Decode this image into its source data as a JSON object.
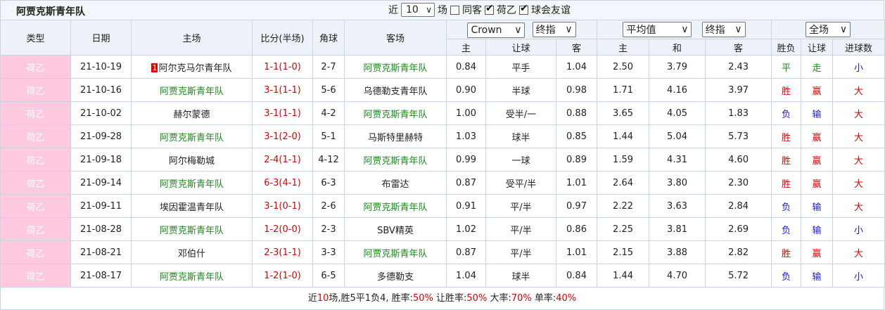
{
  "header": {
    "title": "阿贾克斯青年队",
    "filter_prefix": "近",
    "count_value": "10",
    "filter_suffix": "场",
    "opt_same_side": "同客",
    "opt_same_side_checked": false,
    "opt_league": "荷乙",
    "opt_league_checked": true,
    "opt_friendly": "球会友谊",
    "opt_friendly_checked": true
  },
  "columns": {
    "type": "类型",
    "date": "日期",
    "home": "主场",
    "score": "比分(半场)",
    "corners": "角球",
    "away": "客场",
    "company_select": "Crown",
    "odds_type_select": "终指",
    "avg_select": "平均值",
    "avg_type_select": "终指",
    "scope_select": "全场",
    "sub_home": "主",
    "sub_handicap": "让球",
    "sub_away": "客",
    "sub_home2": "主",
    "sub_draw": "和",
    "sub_away2": "客",
    "sub_result": "胜负",
    "sub_hcap_result": "让球",
    "sub_goals": "进球数"
  },
  "rows": [
    {
      "type": "荷乙",
      "date": "21-10-19",
      "home": "阿尔克马尔青年队",
      "home_rank": "1",
      "home_is_team": false,
      "score": "1-1",
      "half": "(1-0)",
      "corners": "2-7",
      "away": "阿贾克斯青年队",
      "away_is_team": true,
      "h": "0.84",
      "hcap": "平手",
      "a": "1.04",
      "avg_h": "2.50",
      "avg_d": "3.79",
      "avg_a": "2.43",
      "res": "平",
      "res_c": "draw",
      "hres": "走",
      "hres_c": "draw",
      "goals": "小",
      "goals_c": "lose"
    },
    {
      "type": "荷乙",
      "date": "21-10-16",
      "home": "阿贾克斯青年队",
      "home_rank": "",
      "home_is_team": true,
      "score": "3-1",
      "half": "(1-1)",
      "corners": "5-6",
      "away": "乌德勒支青年队",
      "away_is_team": false,
      "h": "0.90",
      "hcap": "半球",
      "a": "0.98",
      "avg_h": "1.71",
      "avg_d": "4.16",
      "avg_a": "3.97",
      "res": "胜",
      "res_c": "win",
      "hres": "赢",
      "hres_c": "win",
      "goals": "大",
      "goals_c": "win"
    },
    {
      "type": "荷乙",
      "date": "21-10-02",
      "home": "赫尔蒙德",
      "home_rank": "",
      "home_is_team": false,
      "score": "3-1",
      "half": "(1-1)",
      "corners": "4-2",
      "away": "阿贾克斯青年队",
      "away_is_team": true,
      "h": "1.00",
      "hcap": "受半/一",
      "a": "0.88",
      "avg_h": "3.65",
      "avg_d": "4.05",
      "avg_a": "1.83",
      "res": "负",
      "res_c": "lose",
      "hres": "输",
      "hres_c": "lose",
      "goals": "大",
      "goals_c": "win"
    },
    {
      "type": "荷乙",
      "date": "21-09-28",
      "home": "阿贾克斯青年队",
      "home_rank": "",
      "home_is_team": true,
      "score": "3-1",
      "half": "(2-0)",
      "corners": "5-1",
      "away": "马斯特里赫特",
      "away_is_team": false,
      "h": "1.03",
      "hcap": "球半",
      "a": "0.85",
      "avg_h": "1.44",
      "avg_d": "5.04",
      "avg_a": "5.73",
      "res": "胜",
      "res_c": "win",
      "hres": "赢",
      "hres_c": "win",
      "goals": "大",
      "goals_c": "win"
    },
    {
      "type": "荷乙",
      "date": "21-09-18",
      "home": "阿尔梅勒城",
      "home_rank": "",
      "home_is_team": false,
      "score": "2-4",
      "half": "(1-1)",
      "corners": "4-12",
      "away": "阿贾克斯青年队",
      "away_is_team": true,
      "h": "0.99",
      "hcap": "一球",
      "a": "0.89",
      "avg_h": "1.59",
      "avg_d": "4.31",
      "avg_a": "4.60",
      "res": "胜",
      "res_c": "win",
      "hres": "赢",
      "hres_c": "win",
      "goals": "大",
      "goals_c": "win"
    },
    {
      "type": "荷乙",
      "date": "21-09-14",
      "home": "阿贾克斯青年队",
      "home_rank": "",
      "home_is_team": true,
      "score": "6-3",
      "half": "(4-1)",
      "corners": "6-3",
      "away": "布雷达",
      "away_is_team": false,
      "h": "0.87",
      "hcap": "受平/半",
      "a": "1.01",
      "avg_h": "2.64",
      "avg_d": "3.80",
      "avg_a": "2.30",
      "res": "胜",
      "res_c": "win",
      "hres": "赢",
      "hres_c": "win",
      "goals": "大",
      "goals_c": "win"
    },
    {
      "type": "荷乙",
      "date": "21-09-11",
      "home": "埃因霍温青年队",
      "home_rank": "",
      "home_is_team": false,
      "score": "3-1",
      "half": "(0-1)",
      "corners": "2-6",
      "away": "阿贾克斯青年队",
      "away_is_team": true,
      "h": "0.91",
      "hcap": "平/半",
      "a": "0.97",
      "avg_h": "2.22",
      "avg_d": "3.63",
      "avg_a": "2.84",
      "res": "负",
      "res_c": "lose",
      "hres": "输",
      "hres_c": "lose",
      "goals": "大",
      "goals_c": "win"
    },
    {
      "type": "荷乙",
      "date": "21-08-28",
      "home": "阿贾克斯青年队",
      "home_rank": "",
      "home_is_team": true,
      "score": "1-2",
      "half": "(0-0)",
      "corners": "2-3",
      "away": "SBV精英",
      "away_is_team": false,
      "h": "1.02",
      "hcap": "平/半",
      "a": "0.86",
      "avg_h": "2.25",
      "avg_d": "3.81",
      "avg_a": "2.69",
      "res": "负",
      "res_c": "lose",
      "hres": "输",
      "hres_c": "lose",
      "goals": "小",
      "goals_c": "lose"
    },
    {
      "type": "荷乙",
      "date": "21-08-21",
      "home": "邓伯什",
      "home_rank": "",
      "home_is_team": false,
      "score": "2-3",
      "half": "(1-1)",
      "corners": "3-3",
      "away": "阿贾克斯青年队",
      "away_is_team": true,
      "h": "0.87",
      "hcap": "平/半",
      "a": "1.01",
      "avg_h": "2.15",
      "avg_d": "3.88",
      "avg_a": "2.82",
      "res": "胜",
      "res_c": "win",
      "hres": "赢",
      "hres_c": "win",
      "goals": "大",
      "goals_c": "win"
    },
    {
      "type": "荷乙",
      "date": "21-08-17",
      "home": "阿贾克斯青年队",
      "home_rank": "",
      "home_is_team": true,
      "score": "1-2",
      "half": "(1-0)",
      "corners": "6-5",
      "away": "多德勒支",
      "away_is_team": false,
      "h": "1.04",
      "hcap": "球半",
      "a": "0.84",
      "avg_h": "1.44",
      "avg_d": "4.70",
      "avg_a": "5.72",
      "res": "负",
      "res_c": "lose",
      "hres": "输",
      "hres_c": "lose",
      "goals": "小",
      "goals_c": "lose"
    }
  ],
  "summary": {
    "p1": "近",
    "games": "10",
    "p2": "场,胜5平1负4, 胜率:",
    "win_rate": "50%",
    "p3": " 让胜率:",
    "hcap_rate": "50%",
    "p4": " 大率:",
    "over_rate": "70%",
    "p5": " 单率:",
    "odd_rate": "40%"
  },
  "colors": {
    "team_highlight": "#1a8a1a",
    "score": "#dd0000",
    "win": "#dd0000",
    "lose": "#1a1acc",
    "draw": "#1a8a1a",
    "league_badge_bg": "#ffc9e0"
  }
}
